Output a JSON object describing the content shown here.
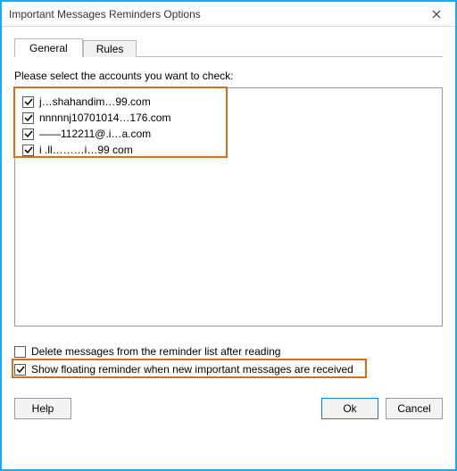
{
  "window": {
    "title": "Important Messages Reminders Options"
  },
  "tabs": {
    "general": "General",
    "rules": "Rules",
    "active": "general"
  },
  "general": {
    "prompt": "Please select the accounts you want to check:",
    "accounts": [
      {
        "label": "j…shahandim…99.com",
        "checked": true
      },
      {
        "label": "nnnnnj10701014…176.com",
        "checked": true
      },
      {
        "label": "——112211@.i…a.com",
        "checked": true
      },
      {
        "label": "i .ll………i…99 com",
        "checked": true
      }
    ],
    "delete_after": {
      "label": "Delete messages from the reminder list after reading",
      "checked": false
    },
    "floating": {
      "label": "Show floating reminder when new important messages are received",
      "checked": true
    }
  },
  "buttons": {
    "help": "Help",
    "ok": "Ok",
    "cancel": "Cancel"
  },
  "colors": {
    "accent": "#1ca8f2",
    "highlight": "#d96f12"
  }
}
